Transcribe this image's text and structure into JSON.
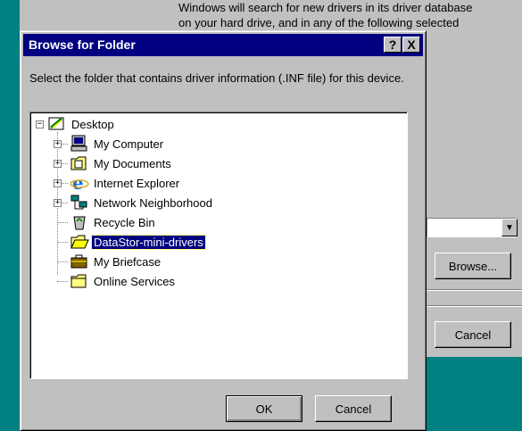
{
  "background_wizard": {
    "text_lines": [
      "Windows will search for new drivers in its driver database",
      "on your hard drive, and in any of the following selected"
    ],
    "browse_button": "Browse...",
    "cancel_button": "Cancel"
  },
  "dialog": {
    "title": "Browse for Folder",
    "help_button": "?",
    "close_button": "X",
    "instruction": "Select the folder that contains driver information (.INF file) for this device.",
    "tree": {
      "root": {
        "label": "Desktop",
        "icon": "desktop-icon",
        "expander": "−"
      },
      "children": [
        {
          "label": "My Computer",
          "icon": "computer-icon",
          "expander": "+"
        },
        {
          "label": "My Documents",
          "icon": "folder-documents-icon",
          "expander": "+"
        },
        {
          "label": "Internet Explorer",
          "icon": "internet-explorer-icon",
          "expander": "+"
        },
        {
          "label": "Network Neighborhood",
          "icon": "network-icon",
          "expander": "+"
        },
        {
          "label": "Recycle Bin",
          "icon": "recycle-bin-icon",
          "expander": ""
        },
        {
          "label": "DataStor-mini-drivers",
          "icon": "open-folder-icon",
          "expander": "",
          "selected": true
        },
        {
          "label": "My Briefcase",
          "icon": "briefcase-icon",
          "expander": ""
        },
        {
          "label": "Online Services",
          "icon": "folder-icon",
          "expander": ""
        }
      ]
    },
    "ok_button": "OK",
    "cancel_button": "Cancel"
  },
  "colors": {
    "titlebar": "#000080",
    "desktop": "#008080",
    "face": "#c0c0c0",
    "selection": "#000080"
  }
}
